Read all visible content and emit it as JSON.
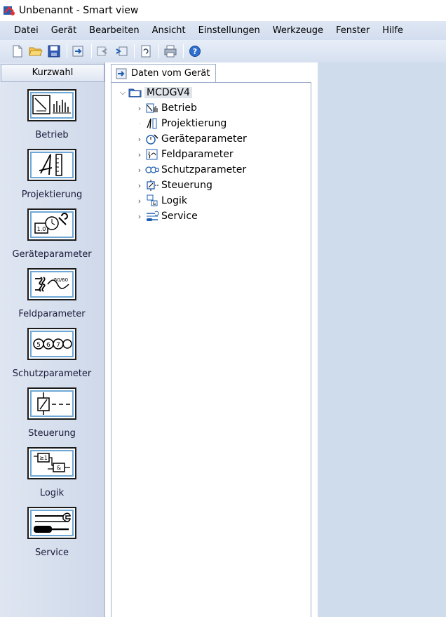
{
  "window": {
    "title": "Unbenannt  - Smart view"
  },
  "menu": [
    "Datei",
    "Gerät",
    "Bearbeiten",
    "Ansicht",
    "Einstellungen",
    "Werkzeuge",
    "Fenster",
    "Hilfe"
  ],
  "toolbar": {
    "buttons": [
      "new-file-icon",
      "open-folder-icon",
      "save-icon",
      "transfer-icon",
      "receive-icon",
      "send-icon",
      "refresh-icon",
      "print-icon",
      "help-icon"
    ]
  },
  "quickbar": {
    "header": "Kurzwahl",
    "items": [
      {
        "label": "Betrieb",
        "icon": "betrieb-icon"
      },
      {
        "label": "Projektierung",
        "icon": "projektierung-icon"
      },
      {
        "label": "Geräteparameter",
        "icon": "geraeteparameter-icon"
      },
      {
        "label": "Feldparameter",
        "icon": "feldparameter-icon"
      },
      {
        "label": "Schutzparameter",
        "icon": "schutzparameter-icon"
      },
      {
        "label": "Steuerung",
        "icon": "steuerung-icon"
      },
      {
        "label": "Logik",
        "icon": "logik-icon"
      },
      {
        "label": "Service",
        "icon": "service-icon"
      }
    ]
  },
  "tree": {
    "tab_label": "Daten vom Gerät",
    "root": "MCDGV4",
    "children": [
      {
        "label": "Betrieb",
        "expandable": true
      },
      {
        "label": "Projektierung",
        "expandable": false
      },
      {
        "label": "Geräteparameter",
        "expandable": true
      },
      {
        "label": "Feldparameter",
        "expandable": true
      },
      {
        "label": "Schutzparameter",
        "expandable": true
      },
      {
        "label": "Steuerung",
        "expandable": true
      },
      {
        "label": "Logik",
        "expandable": true
      },
      {
        "label": "Service",
        "expandable": true
      }
    ]
  },
  "colors": {
    "accent": "#1f5fb0",
    "panel": "#cfdcec",
    "menubar": "#d8e2f1"
  }
}
